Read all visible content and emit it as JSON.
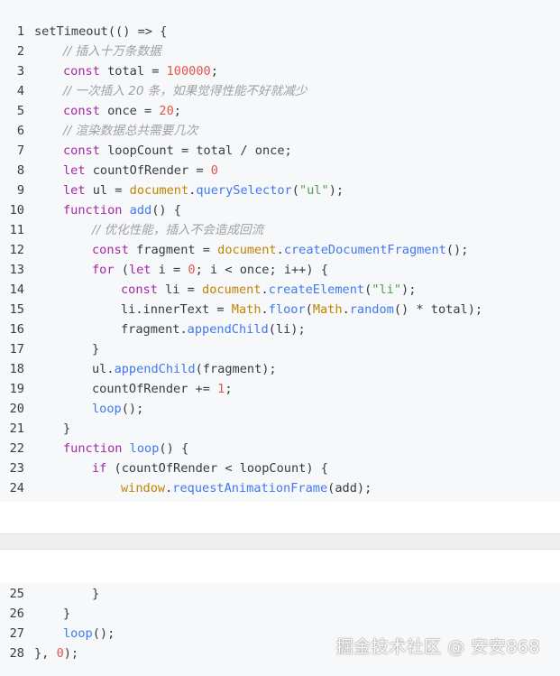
{
  "colors": {
    "background": "#f6f8fa",
    "keyword": "#a626a4",
    "function": "#4078f2",
    "string": "#50a14f",
    "number": "#e45649",
    "comment": "#a0a1a7",
    "object": "#c18401",
    "plain": "#383a42"
  },
  "code_top": [
    {
      "n": "1",
      "indent": 0,
      "tokens": [
        [
          "pl",
          "setTimeout(() => {"
        ]
      ]
    },
    {
      "n": "2",
      "indent": 1,
      "tokens": [
        [
          "cm",
          "// 插入十万条数据"
        ]
      ]
    },
    {
      "n": "3",
      "indent": 1,
      "tokens": [
        [
          "kw",
          "const"
        ],
        [
          "pl",
          " total = "
        ],
        [
          "num",
          "100000"
        ],
        [
          "pl",
          ";"
        ]
      ]
    },
    {
      "n": "4",
      "indent": 1,
      "tokens": [
        [
          "cm",
          "// 一次插入 20 条，如果觉得性能不好就减少"
        ]
      ]
    },
    {
      "n": "5",
      "indent": 1,
      "tokens": [
        [
          "kw",
          "const"
        ],
        [
          "pl",
          " once = "
        ],
        [
          "num",
          "20"
        ],
        [
          "pl",
          ";"
        ]
      ]
    },
    {
      "n": "6",
      "indent": 1,
      "tokens": [
        [
          "cm",
          "// 渲染数据总共需要几次"
        ]
      ]
    },
    {
      "n": "7",
      "indent": 1,
      "tokens": [
        [
          "kw",
          "const"
        ],
        [
          "pl",
          " loopCount = total / once;"
        ]
      ]
    },
    {
      "n": "8",
      "indent": 1,
      "tokens": [
        [
          "kw",
          "let"
        ],
        [
          "pl",
          " countOfRender = "
        ],
        [
          "num",
          "0"
        ]
      ]
    },
    {
      "n": "9",
      "indent": 1,
      "tokens": [
        [
          "kw",
          "let"
        ],
        [
          "pl",
          " ul = "
        ],
        [
          "ob",
          "document"
        ],
        [
          "pl",
          "."
        ],
        [
          "fn",
          "querySelector"
        ],
        [
          "pl",
          "("
        ],
        [
          "str",
          "\"ul\""
        ],
        [
          "pl",
          ");"
        ]
      ]
    },
    {
      "n": "10",
      "indent": 1,
      "tokens": [
        [
          "kw",
          "function"
        ],
        [
          "pl",
          " "
        ],
        [
          "fn",
          "add"
        ],
        [
          "pl",
          "() {"
        ]
      ]
    },
    {
      "n": "11",
      "indent": 2,
      "tokens": [
        [
          "cm",
          "// 优化性能，插入不会造成回流"
        ]
      ]
    },
    {
      "n": "12",
      "indent": 2,
      "tokens": [
        [
          "kw",
          "const"
        ],
        [
          "pl",
          " fragment = "
        ],
        [
          "ob",
          "document"
        ],
        [
          "pl",
          "."
        ],
        [
          "fn",
          "createDocumentFragment"
        ],
        [
          "pl",
          "();"
        ]
      ]
    },
    {
      "n": "13",
      "indent": 2,
      "tokens": [
        [
          "kw",
          "for"
        ],
        [
          "pl",
          " ("
        ],
        [
          "kw",
          "let"
        ],
        [
          "pl",
          " i = "
        ],
        [
          "num",
          "0"
        ],
        [
          "pl",
          "; i < once; i++) {"
        ]
      ]
    },
    {
      "n": "14",
      "indent": 3,
      "tokens": [
        [
          "kw",
          "const"
        ],
        [
          "pl",
          " li = "
        ],
        [
          "ob",
          "document"
        ],
        [
          "pl",
          "."
        ],
        [
          "fn",
          "createElement"
        ],
        [
          "pl",
          "("
        ],
        [
          "str",
          "\"li\""
        ],
        [
          "pl",
          ");"
        ]
      ]
    },
    {
      "n": "15",
      "indent": 3,
      "tokens": [
        [
          "pl",
          "li.innerText = "
        ],
        [
          "ob",
          "Math"
        ],
        [
          "pl",
          "."
        ],
        [
          "fn",
          "floor"
        ],
        [
          "pl",
          "("
        ],
        [
          "ob",
          "Math"
        ],
        [
          "pl",
          "."
        ],
        [
          "fn",
          "random"
        ],
        [
          "pl",
          "() * total);"
        ]
      ]
    },
    {
      "n": "16",
      "indent": 3,
      "tokens": [
        [
          "pl",
          "fragment."
        ],
        [
          "fn",
          "appendChild"
        ],
        [
          "pl",
          "(li);"
        ]
      ]
    },
    {
      "n": "17",
      "indent": 2,
      "tokens": [
        [
          "pl",
          "}"
        ]
      ]
    },
    {
      "n": "18",
      "indent": 2,
      "tokens": [
        [
          "pl",
          "ul."
        ],
        [
          "fn",
          "appendChild"
        ],
        [
          "pl",
          "(fragment);"
        ]
      ]
    },
    {
      "n": "19",
      "indent": 2,
      "tokens": [
        [
          "pl",
          "countOfRender += "
        ],
        [
          "num",
          "1"
        ],
        [
          "pl",
          ";"
        ]
      ]
    },
    {
      "n": "20",
      "indent": 2,
      "tokens": [
        [
          "fn",
          "loop"
        ],
        [
          "pl",
          "();"
        ]
      ]
    },
    {
      "n": "21",
      "indent": 1,
      "tokens": [
        [
          "pl",
          "}"
        ]
      ]
    },
    {
      "n": "22",
      "indent": 1,
      "tokens": [
        [
          "kw",
          "function"
        ],
        [
          "pl",
          " "
        ],
        [
          "fn",
          "loop"
        ],
        [
          "pl",
          "() {"
        ]
      ]
    },
    {
      "n": "23",
      "indent": 2,
      "tokens": [
        [
          "kw",
          "if"
        ],
        [
          "pl",
          " (countOfRender < loopCount) {"
        ]
      ]
    },
    {
      "n": "24",
      "indent": 3,
      "tokens": [
        [
          "ob",
          "window"
        ],
        [
          "pl",
          "."
        ],
        [
          "fn",
          "requestAnimationFrame"
        ],
        [
          "pl",
          "(add);"
        ]
      ]
    }
  ],
  "code_bottom": [
    {
      "n": "25",
      "indent": 2,
      "tokens": [
        [
          "pl",
          "}"
        ]
      ]
    },
    {
      "n": "26",
      "indent": 1,
      "tokens": [
        [
          "pl",
          "}"
        ]
      ]
    },
    {
      "n": "27",
      "indent": 1,
      "tokens": [
        [
          "fn",
          "loop"
        ],
        [
          "pl",
          "();"
        ]
      ]
    },
    {
      "n": "28",
      "indent": 0,
      "tokens": [
        [
          "pl",
          "}, "
        ],
        [
          "num",
          "0"
        ],
        [
          "pl",
          ");"
        ]
      ]
    }
  ],
  "watermark": "掘金技术社区 @ 安安868"
}
